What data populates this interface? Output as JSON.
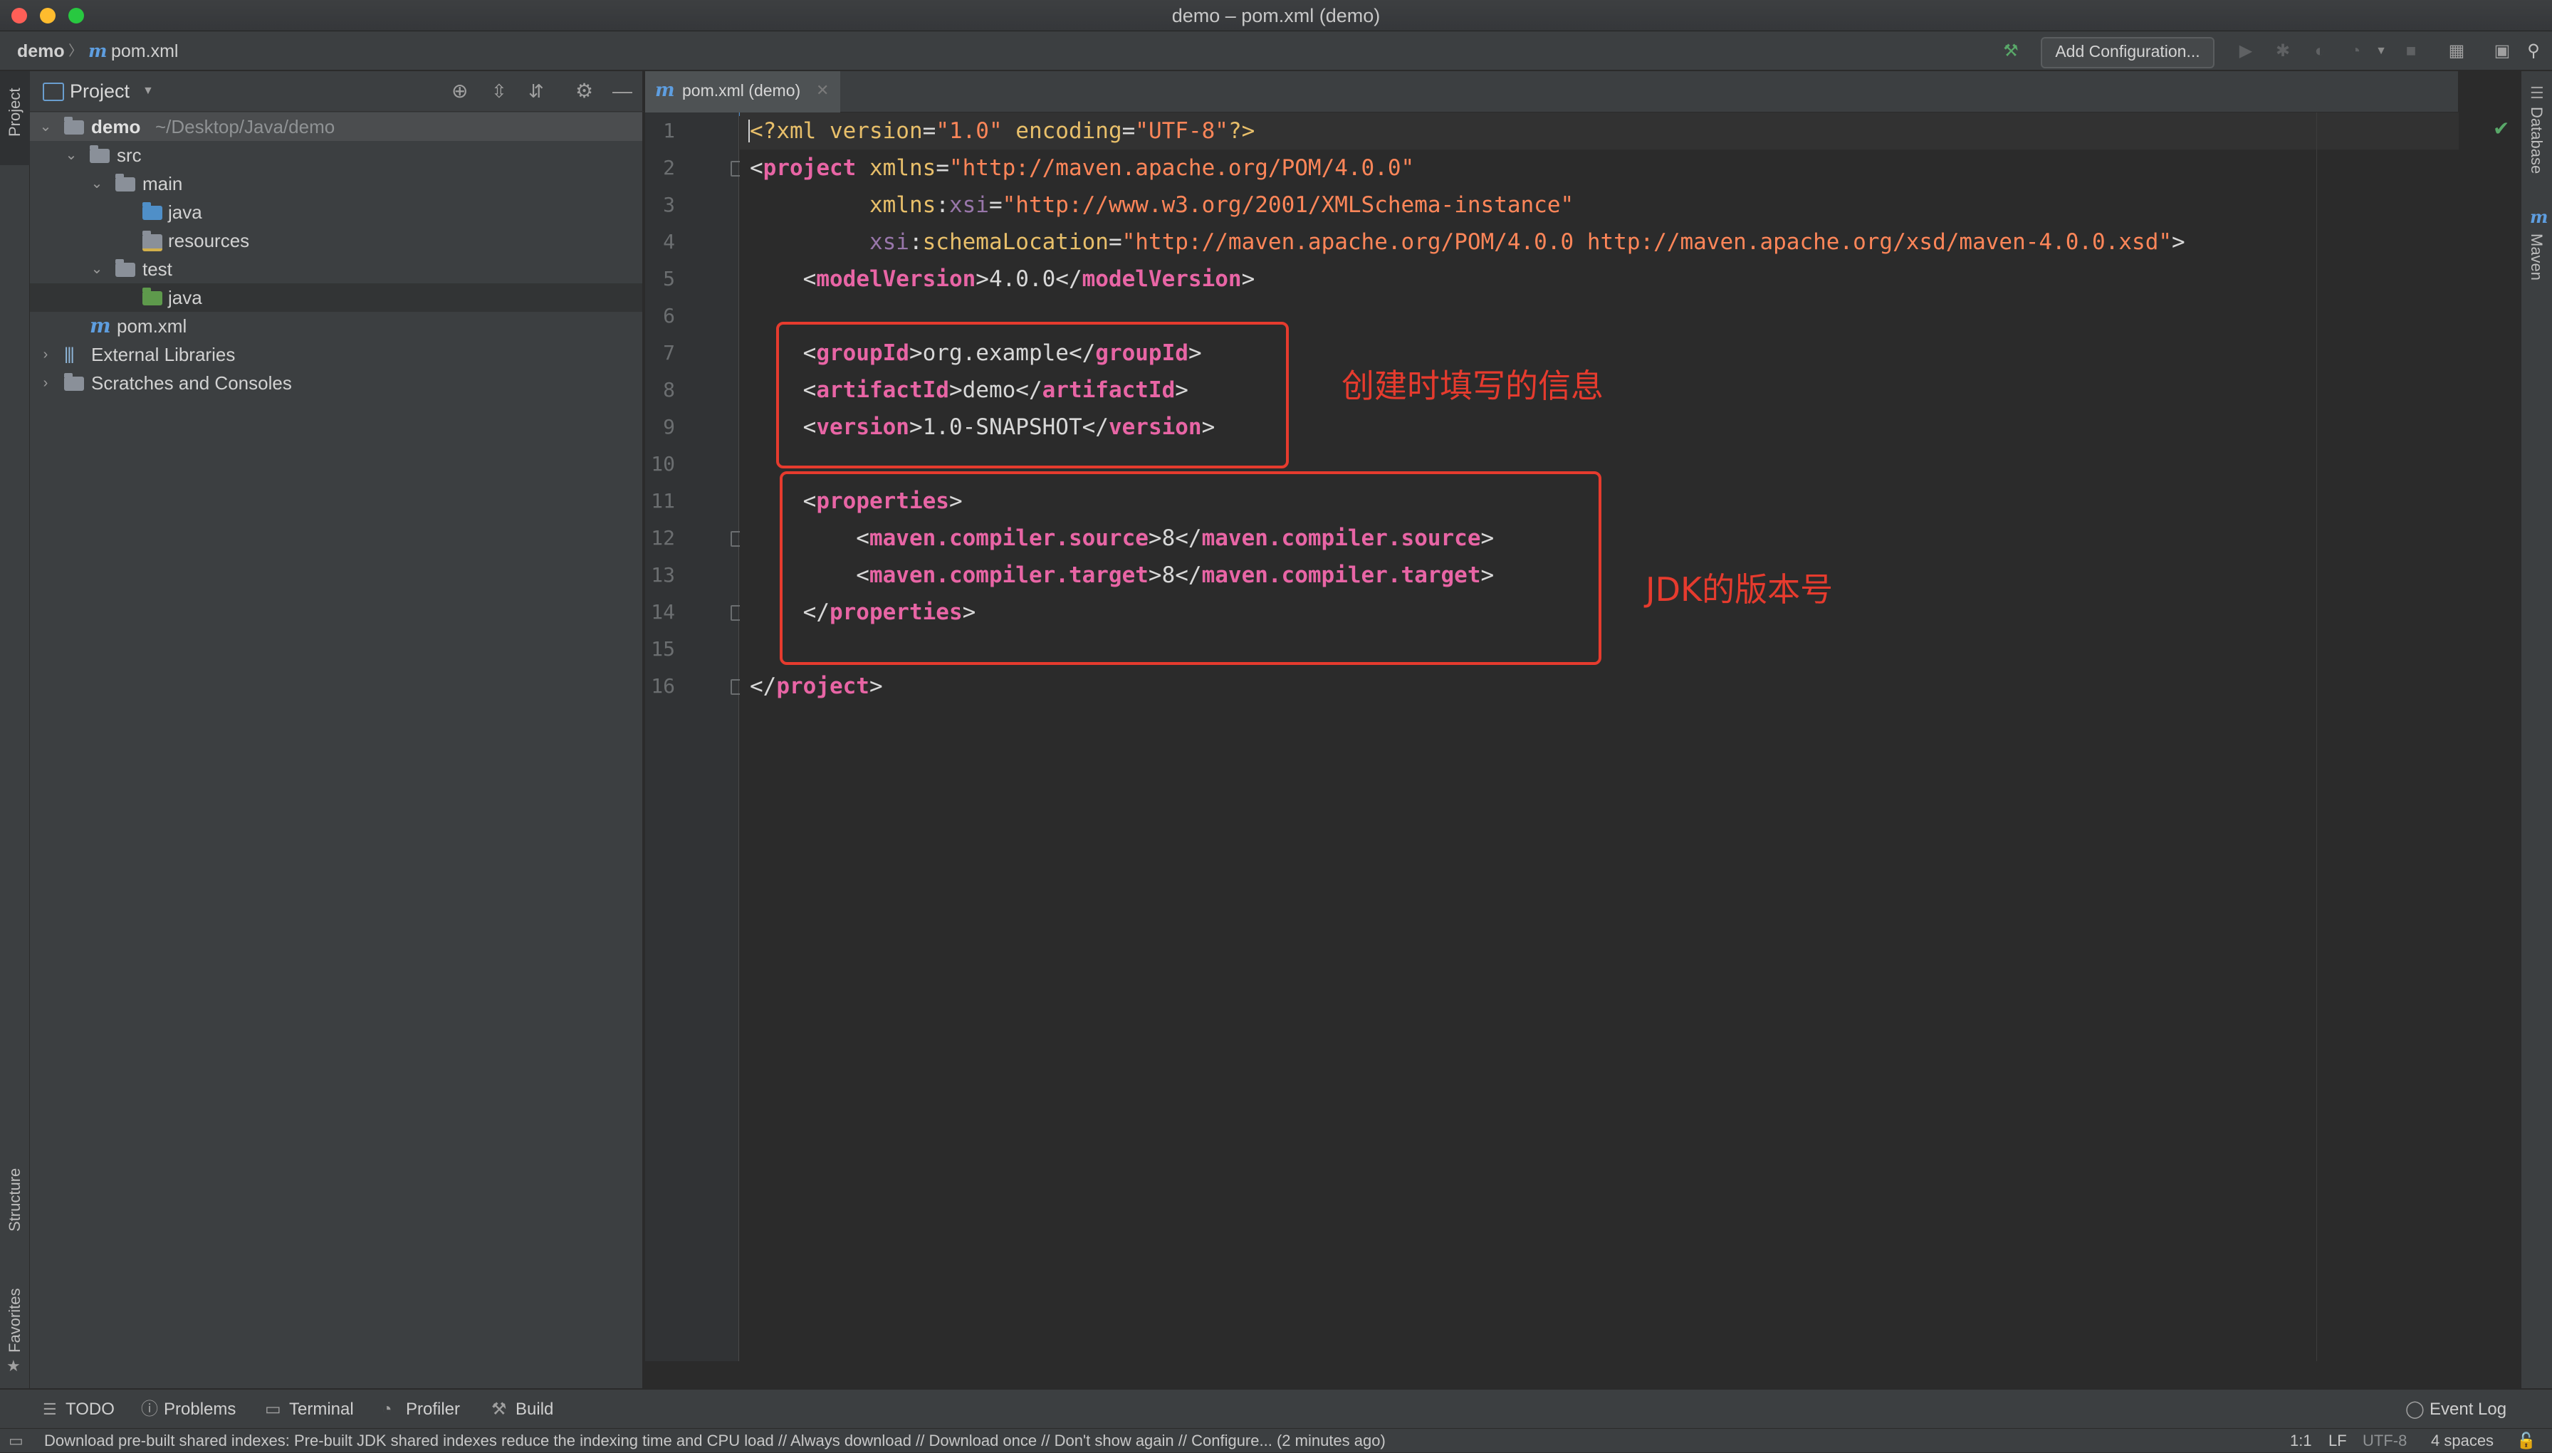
{
  "window": {
    "title": "demo – pom.xml (demo)"
  },
  "breadcrumb": {
    "project": "demo",
    "file": "pom.xml",
    "sep": "〉"
  },
  "toolbar": {
    "add_configuration": "Add Configuration..."
  },
  "project_panel": {
    "title": "Project",
    "tree": [
      {
        "label": "demo",
        "hint": "~/Desktop/Java/demo",
        "depth": 0,
        "expanded": true,
        "icon": "module-folder-icon"
      },
      {
        "label": "src",
        "depth": 1,
        "expanded": true,
        "icon": "folder-icon"
      },
      {
        "label": "main",
        "depth": 2,
        "expanded": true,
        "icon": "folder-icon"
      },
      {
        "label": "java",
        "depth": 3,
        "icon": "source-folder-icon"
      },
      {
        "label": "resources",
        "depth": 3,
        "icon": "resources-folder-icon"
      },
      {
        "label": "test",
        "depth": 2,
        "expanded": true,
        "icon": "folder-icon"
      },
      {
        "label": "java",
        "depth": 3,
        "icon": "test-folder-icon"
      },
      {
        "label": "pom.xml",
        "depth": 1,
        "icon": "maven-file-icon"
      },
      {
        "label": "External Libraries",
        "depth": 0,
        "expanded": false,
        "icon": "libraries-icon"
      },
      {
        "label": "Scratches and Consoles",
        "depth": 0,
        "expanded": false,
        "icon": "scratches-icon"
      }
    ]
  },
  "left_stripe": {
    "project": "Project",
    "structure": "Structure",
    "favorites": "Favorites"
  },
  "right_stripe": {
    "database": "Database",
    "maven": "Maven"
  },
  "editor": {
    "tab": "pom.xml (demo)",
    "line_numbers": [
      "1",
      "2",
      "3",
      "4",
      "5",
      "6",
      "7",
      "8",
      "9",
      "10",
      "11",
      "12",
      "13",
      "14",
      "15",
      "16"
    ],
    "lines": {
      "l1": {
        "a": "<?",
        "b": "xml ",
        "c": "version",
        "d": "=",
        "e": "\"1.0\"",
        "f": " encoding",
        "g": "=",
        "h": "\"UTF-8\"",
        "i": "?>"
      },
      "l2": {
        "a": "<",
        "b": "project",
        "c": " xmlns",
        "d": "=",
        "e": "\"http://maven.apache.org/POM/4.0.0\""
      },
      "l3": {
        "a": "         xmlns",
        "b": ":",
        "c": "xsi",
        "d": "=",
        "e": "\"http://www.w3.org/2001/XMLSchema-instance\""
      },
      "l4": {
        "a": "         xsi",
        "b": ":",
        "c": "schemaLocation",
        "d": "=",
        "e": "\"http://maven.apache.org/POM/4.0.0 http://maven.apache.org/xsd/maven-4.0.0.xsd\"",
        "f": ">"
      },
      "l5": {
        "a": "    <",
        "b": "modelVersion",
        "c": ">4.0.0</",
        "d": "modelVersion",
        "e": ">"
      },
      "l7": {
        "a": "    <",
        "b": "groupId",
        "c": ">org.example</",
        "d": "groupId",
        "e": ">"
      },
      "l8": {
        "a": "    <",
        "b": "artifactId",
        "c": ">demo</",
        "d": "artifactId",
        "e": ">"
      },
      "l9": {
        "a": "    <",
        "b": "version",
        "c": ">1.0-SNAPSHOT</",
        "d": "version",
        "e": ">"
      },
      "l11": {
        "a": "    <",
        "b": "properties",
        "c": ">"
      },
      "l12": {
        "a": "        <",
        "b": "maven.compiler.source",
        "c": ">8</",
        "d": "maven.compiler.source",
        "e": ">"
      },
      "l13": {
        "a": "        <",
        "b": "maven.compiler.target",
        "c": ">8</",
        "d": "maven.compiler.target",
        "e": ">"
      },
      "l14": {
        "a": "    </",
        "b": "properties",
        "c": ">"
      },
      "l16": {
        "a": "</",
        "b": "project",
        "c": ">"
      }
    }
  },
  "annotations": {
    "coords_note": "创建时填写的信息",
    "jdk_note": "JDK的版本号",
    "color": "#e63b2e"
  },
  "tool_windows": {
    "todo": "TODO",
    "problems": "Problems",
    "terminal": "Terminal",
    "profiler": "Profiler",
    "build": "Build",
    "event_log": "Event Log"
  },
  "status": {
    "message": "Download pre-built shared indexes: Pre-built JDK shared indexes reduce the indexing time and CPU load // Always download // Download once // Don't show again // Configure... (2 minutes ago)",
    "position": "1:1",
    "line_sep": "LF",
    "encoding": "UTF-8",
    "indent": "4 spaces"
  },
  "colors": {
    "accent": "#4a88c7",
    "tag": "#e865a5",
    "string": "#ff8659",
    "attribute": "#e8bf6a",
    "namespace": "#9876aa"
  }
}
